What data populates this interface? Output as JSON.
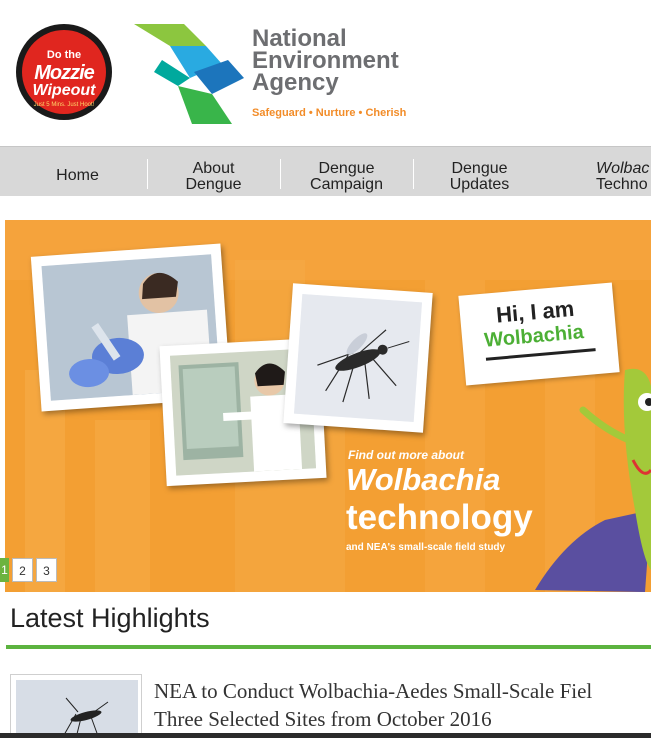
{
  "campaign_logo": {
    "line1": "Do the",
    "line2": "Mozzie",
    "line3": "Wipeout",
    "tagline": "Just 5 Mins. Just Hoot!"
  },
  "agency": {
    "name_lines": [
      "National",
      "Environment",
      "Agency"
    ],
    "tagline": "Safeguard • Nurture • Cherish"
  },
  "nav": {
    "items": [
      {
        "lines": [
          "Home"
        ]
      },
      {
        "lines": [
          "About",
          "Dengue"
        ]
      },
      {
        "lines": [
          "Dengue",
          "Campaign"
        ]
      },
      {
        "lines": [
          "Dengue",
          "Updates"
        ]
      },
      {
        "lines": [
          "Wolbac",
          "Techno"
        ]
      }
    ]
  },
  "banner": {
    "speech_line1": "Hi, I am",
    "speech_line2": "Wolbachia",
    "kicker": "Find out more about",
    "title1": "Wolbachia",
    "title2": "technology",
    "subtitle": "and NEA's small-scale field study",
    "pager": {
      "active": "1",
      "pages": [
        "2",
        "3"
      ]
    }
  },
  "highlights": {
    "heading": "Latest Highlights",
    "items": [
      {
        "title_line1": "NEA to Conduct Wolbachia-Aedes Small-Scale Fiel",
        "title_line2": "Three Selected Sites from October 2016"
      }
    ]
  },
  "colors": {
    "banner_orange": "#f5a33c",
    "accent_green": "#5cb33f",
    "nav_grey": "#d8d8d8",
    "agency_orange": "#f28c28"
  }
}
